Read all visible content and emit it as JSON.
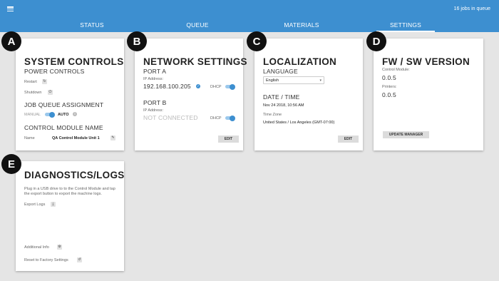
{
  "header": {
    "queue_count": "16 jobs in queue",
    "tabs": [
      {
        "label": "STATUS",
        "active": false
      },
      {
        "label": "QUEUE",
        "active": false
      },
      {
        "label": "MATERIALS",
        "active": false
      },
      {
        "label": "SETTINGS",
        "active": true
      }
    ]
  },
  "badges": [
    "A",
    "B",
    "C",
    "D",
    "E"
  ],
  "system_controls": {
    "title": "SYSTEM CONTROLS",
    "power_heading": "POWER CONTROLS",
    "restart_label": "Restart",
    "shutdown_label": "Shutdown",
    "queue_heading": "JOB QUEUE ASSIGNMENT",
    "manual_label": "MANUAL",
    "auto_label": "AUTO",
    "module_heading": "CONTROL MODULE NAME",
    "name_label": "Name",
    "name_value": "QA Control Module Unit 1"
  },
  "network": {
    "title": "NETWORK SETTINGS",
    "port_a": {
      "heading": "PORT A",
      "ip_label": "IP Address:",
      "ip_value": "192.168.100.205",
      "dhcp_label": "DHCP"
    },
    "port_b": {
      "heading": "PORT B",
      "ip_label": "IP Address:",
      "ip_value": "NOT CONNECTED",
      "dhcp_label": "DHCP"
    },
    "edit_label": "EDIT"
  },
  "localization": {
    "title": "LOCALIZATION",
    "language_heading": "LANGUAGE",
    "language_value": "English",
    "datetime_heading": "DATE / TIME",
    "datetime_value": "Nov 24 2018, 10:56 AM",
    "timezone_label": "Time Zone",
    "timezone_value": "United States / Los Angeles (GMT-07:00)",
    "edit_label": "EDIT"
  },
  "version": {
    "title": "FW / SW VERSION",
    "control_module_label": "Control Module:",
    "control_module_value": "0.0.5",
    "printers_label": "Printers:",
    "printers_value": "0.0.5",
    "update_label": "UPDATE MANAGER"
  },
  "diagnostics": {
    "title": "DIAGNOSTICS/LOGS",
    "description_1": "Plug in a USB drive to to the Control Module and tap",
    "description_2": "the export button to export the machine logs.",
    "export_label": "Export Logs",
    "additional_label": "Additional Info",
    "reset_label": "Reset to Factory Settings"
  }
}
